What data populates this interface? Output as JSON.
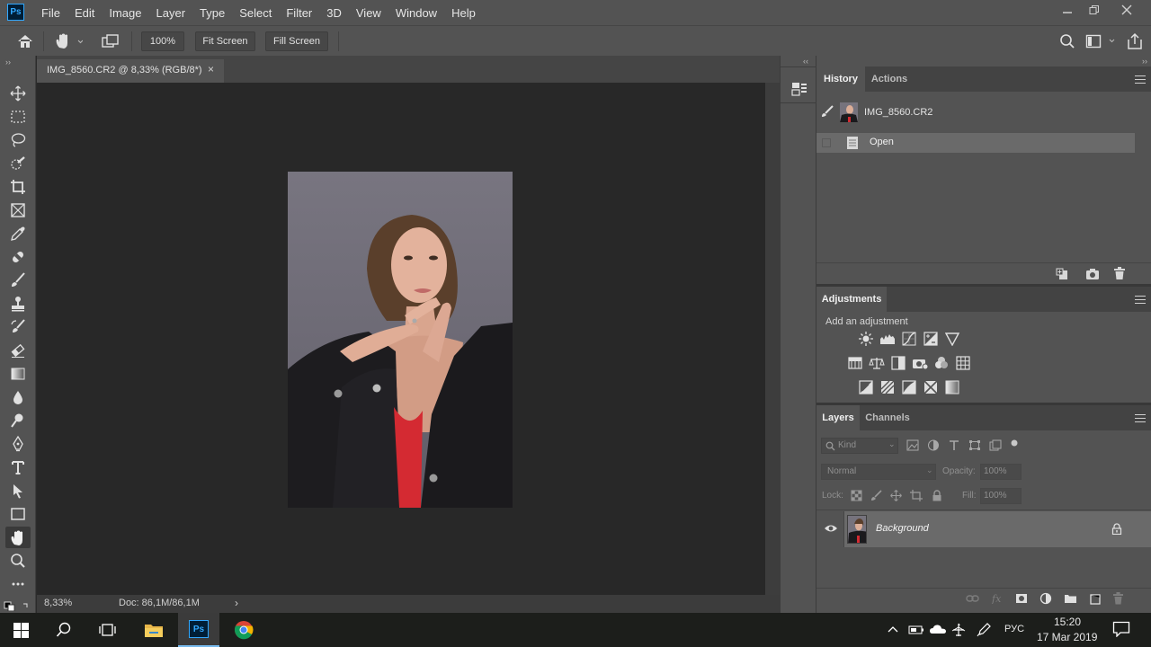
{
  "app": {
    "logo": "Ps",
    "menu": [
      "File",
      "Edit",
      "Image",
      "Layer",
      "Type",
      "Select",
      "Filter",
      "3D",
      "View",
      "Window",
      "Help"
    ]
  },
  "options_bar": {
    "zoom_value": "100%",
    "fit_screen": "Fit Screen",
    "fill_screen": "Fill Screen"
  },
  "document": {
    "tab_title": "IMG_8560.CR2 @ 8,33% (RGB/8*)",
    "status_zoom": "8,33%",
    "status_doc": "Doc: 86,1M/86,1M"
  },
  "history": {
    "tabs": [
      "History",
      "Actions"
    ],
    "snapshot": "IMG_8560.CR2",
    "states": [
      "Open"
    ]
  },
  "adjustments": {
    "tab": "Adjustments",
    "hint": "Add an adjustment"
  },
  "layers": {
    "tabs": [
      "Layers",
      "Channels"
    ],
    "kind_placeholder": "Kind",
    "blend_mode": "Normal",
    "opacity_label": "Opacity:",
    "opacity_value": "100%",
    "lock_label": "Lock:",
    "fill_label": "Fill:",
    "fill_value": "100%",
    "layer_name": "Background"
  },
  "taskbar": {
    "language": "РУС",
    "time": "15:20",
    "date": "17 Mar 2019"
  },
  "colors": {
    "accent": "#31a8ff",
    "panel": "#535353",
    "canvas": "#282828"
  }
}
